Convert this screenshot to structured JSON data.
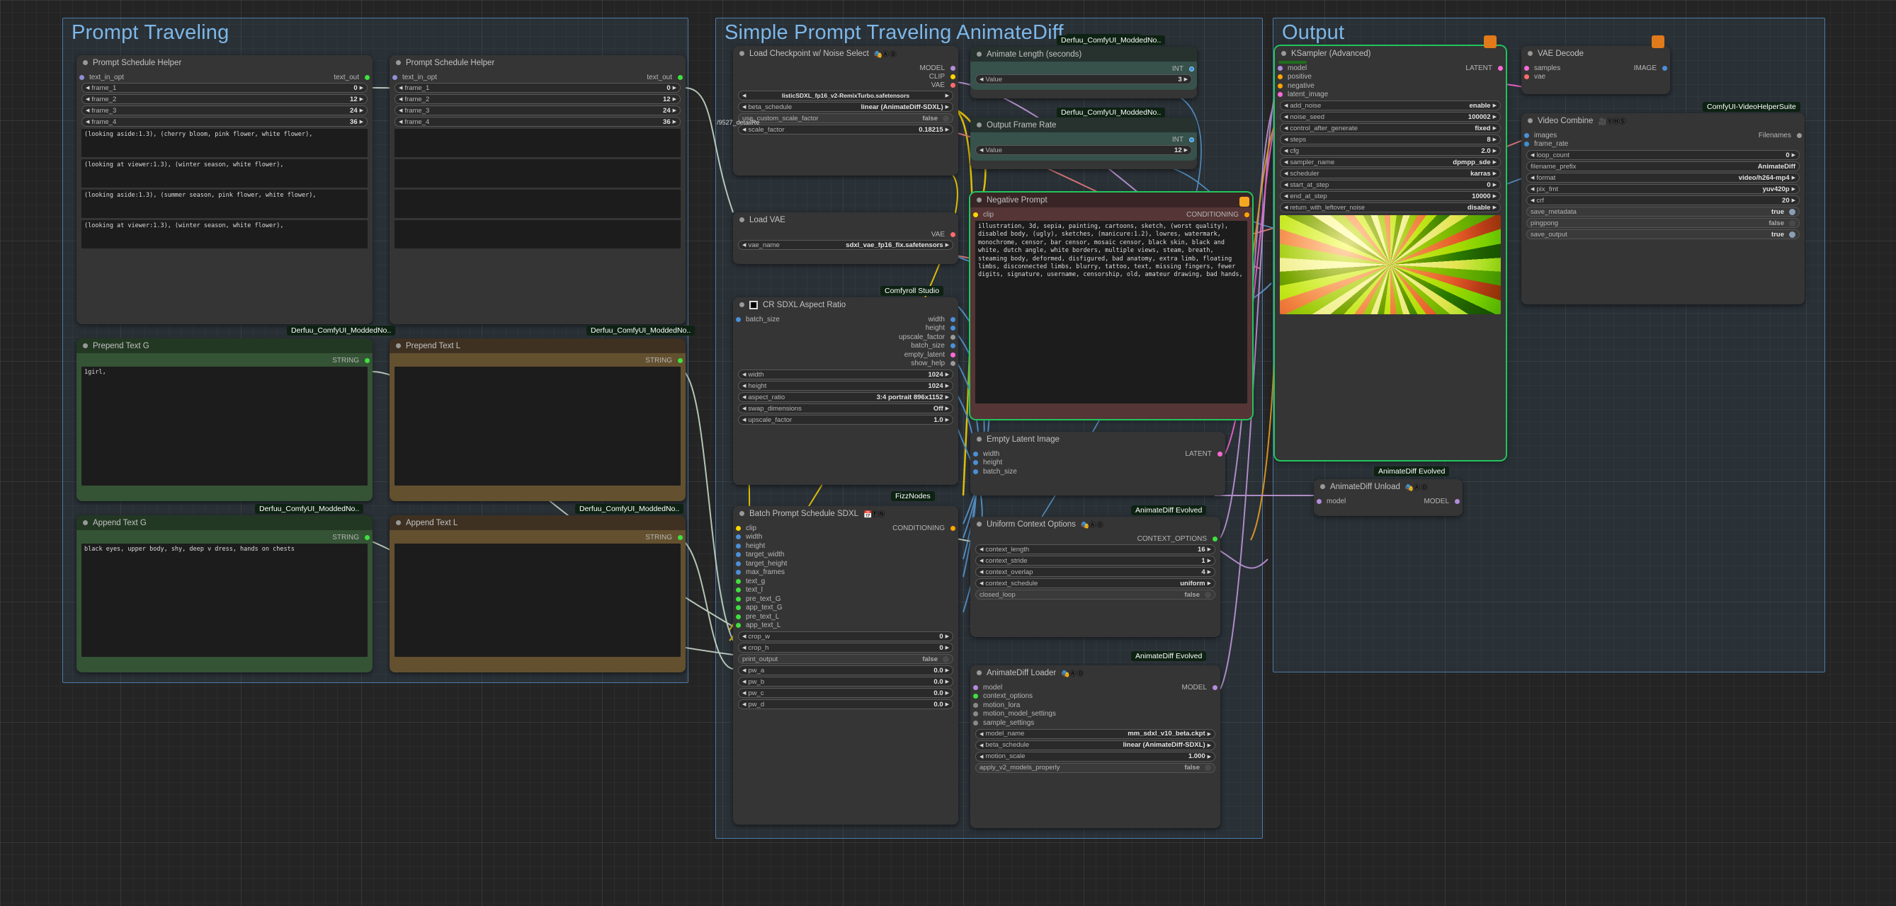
{
  "groups": [
    {
      "name": "Prompt Traveling"
    },
    {
      "name": "Simple Prompt Traveling AnimateDiff"
    },
    {
      "name": "Output"
    }
  ],
  "badges": {
    "derfuu": "Derfuu_ComfyUI_ModdedNo..",
    "animatediff": "AnimateDiff Evolved",
    "comfyroll": "Comfyroll Studio",
    "fizznodes": "FizzNodes",
    "vhs": "ComfyUI-VideoHelperSuite"
  },
  "link_labels": {
    "ckpt_link": "/9527_detailRe"
  },
  "nodes": {
    "prompt_schedule_helper_1": {
      "title": "Prompt Schedule Helper",
      "input": "text_in_opt",
      "output": "text_out",
      "widgets": [
        {
          "label": "frame_1",
          "value": "0"
        },
        {
          "label": "frame_2",
          "value": "12"
        },
        {
          "label": "frame_3",
          "value": "24"
        },
        {
          "label": "frame_4",
          "value": "36"
        }
      ],
      "texts": [
        "(looking aside:1.3), (cherry bloom, pink flower, white flower),",
        "(looking at viewer:1.3), (winter season, white flower),",
        "(looking aside:1.3), (summer season, pink flower, white flower),",
        "(looking at viewer:1.3), (winter season, white flower),"
      ]
    },
    "prompt_schedule_helper_2": {
      "title": "Prompt Schedule Helper",
      "input": "text_in_opt",
      "output": "text_out",
      "widgets": [
        {
          "label": "frame_1",
          "value": "0"
        },
        {
          "label": "frame_2",
          "value": "12"
        },
        {
          "label": "frame_3",
          "value": "24"
        },
        {
          "label": "frame_4",
          "value": "36"
        }
      ],
      "texts": [
        "",
        "",
        "",
        ""
      ]
    },
    "prepend_text_g": {
      "title": "Prepend Text G",
      "output": "STRING",
      "text": "1girl,"
    },
    "prepend_text_l": {
      "title": "Prepend Text L",
      "output": "STRING",
      "text": ""
    },
    "append_text_g": {
      "title": "Append Text G",
      "output": "STRING",
      "text": "black eyes, upper body, shy, deep v dress, hands on chests"
    },
    "append_text_l": {
      "title": "Append Text L",
      "output": "STRING",
      "text": ""
    },
    "load_checkpoint": {
      "title": "Load Checkpoint w/ Noise Select",
      "icons": "🎭Ⓐ Ⓓ",
      "outputs": [
        "MODEL",
        "CLIP",
        "VAE"
      ],
      "widgets": [
        {
          "label": "",
          "value": "listicSDXL_fp16_v2-RemixTurbo.safetensors",
          "combo": true
        },
        {
          "label": "beta_schedule",
          "value": "linear (AnimateDiff-SDXL)"
        },
        {
          "label": "use_custom_scale_factor",
          "value": "false",
          "toggle": true,
          "on": false
        },
        {
          "label": "scale_factor",
          "value": "0.18215"
        }
      ]
    },
    "load_vae": {
      "title": "Load VAE",
      "outputs": [
        "VAE"
      ],
      "widgets": [
        {
          "label": "vae_name",
          "value": "sdxl_vae_fp16_fix.safetensors"
        }
      ]
    },
    "cr_sdxl_aspect_ratio": {
      "title": "CR SDXL Aspect Ratio",
      "inputs": [
        "batch_size"
      ],
      "outputs": [
        "width",
        "height",
        "upscale_factor",
        "batch_size",
        "empty_latent",
        "show_help"
      ],
      "widgets": [
        {
          "label": "width",
          "value": "1024"
        },
        {
          "label": "height",
          "value": "1024"
        },
        {
          "label": "aspect_ratio",
          "value": "3:4 portrait 896x1152"
        },
        {
          "label": "swap_dimensions",
          "value": "Off"
        },
        {
          "label": "upscale_factor",
          "value": "1.0"
        }
      ]
    },
    "batch_prompt_schedule_sdxl": {
      "title": "Batch Prompt Schedule SDXL",
      "icons": "📅ⒻⓃ",
      "inputs": [
        "clip",
        "width",
        "height",
        "target_width",
        "target_height",
        "max_frames",
        "text_g",
        "text_l",
        "pre_text_G",
        "app_text_G",
        "pre_text_L",
        "app_text_L"
      ],
      "outputs": [
        "CONDITIONING"
      ],
      "widgets": [
        {
          "label": "crop_w",
          "value": "0"
        },
        {
          "label": "crop_h",
          "value": "0"
        },
        {
          "label": "print_output",
          "value": "false",
          "toggle": true,
          "on": false
        },
        {
          "label": "pw_a",
          "value": "0.0"
        },
        {
          "label": "pw_b",
          "value": "0.0"
        },
        {
          "label": "pw_c",
          "value": "0.0"
        },
        {
          "label": "pw_d",
          "value": "0.0"
        }
      ]
    },
    "animate_length": {
      "title": "Animate Length (seconds)",
      "outputs": [
        "INT"
      ],
      "widgets": [
        {
          "label": "Value",
          "value": "3"
        }
      ]
    },
    "output_frame_rate": {
      "title": "Output Frame Rate",
      "outputs": [
        "INT"
      ],
      "widgets": [
        {
          "label": "Value",
          "value": "12"
        }
      ]
    },
    "negative_prompt": {
      "title": "Negative Prompt",
      "inputs": [
        "clip"
      ],
      "outputs": [
        "CONDITIONING"
      ],
      "text": "illustration, 3d, sepia, painting, cartoons, sketch, (worst quality), disabled body, (ugly), sketches, (manicure:1.2), lowres, watermark, monochrome, censor, bar censor, mosaic censor, black skin, black and white, dutch angle, white borders, multiple views, steam, breath, steaming body, deformed, disfigured, bad anatomy, extra limb, floating limbs, disconnected limbs, blurry, tattoo, text, missing fingers, fewer digits, signature, username, censorship, old, amateur drawing, bad hands,"
    },
    "empty_latent_image": {
      "title": "Empty Latent Image",
      "inputs": [
        "width",
        "height",
        "batch_size"
      ],
      "outputs": [
        "LATENT"
      ]
    },
    "uniform_context_options": {
      "title": "Uniform Context Options",
      "icons": "🎭Ⓐ Ⓓ",
      "outputs": [
        "CONTEXT_OPTIONS"
      ],
      "widgets": [
        {
          "label": "context_length",
          "value": "16"
        },
        {
          "label": "context_stride",
          "value": "1"
        },
        {
          "label": "context_overlap",
          "value": "4"
        },
        {
          "label": "context_schedule",
          "value": "uniform"
        },
        {
          "label": "closed_loop",
          "value": "false",
          "toggle": true,
          "on": false
        }
      ]
    },
    "animatediff_loader": {
      "title": "AnimateDiff Loader",
      "icons": "🎭Ⓐ Ⓓ",
      "inputs": [
        "model",
        "context_options",
        "motion_lora",
        "motion_model_settings",
        "sample_settings"
      ],
      "outputs": [
        "MODEL"
      ],
      "widgets": [
        {
          "label": "model_name",
          "value": "mm_sdxl_v10_beta.ckpt"
        },
        {
          "label": "beta_schedule",
          "value": "linear (AnimateDiff-SDXL)"
        },
        {
          "label": "motion_scale",
          "value": "1.000"
        },
        {
          "label": "apply_v2_models_properly",
          "value": "false",
          "toggle": true,
          "on": false
        }
      ]
    },
    "ksampler_advanced": {
      "title": "KSampler (Advanced)",
      "inputs": [
        "model",
        "positive",
        "negative",
        "latent_image"
      ],
      "outputs": [
        "LATENT"
      ],
      "widgets": [
        {
          "label": "add_noise",
          "value": "enable"
        },
        {
          "label": "noise_seed",
          "value": "100002"
        },
        {
          "label": "control_after_generate",
          "value": "fixed"
        },
        {
          "label": "steps",
          "value": "8"
        },
        {
          "label": "cfg",
          "value": "2.0"
        },
        {
          "label": "sampler_name",
          "value": "dpmpp_sde"
        },
        {
          "label": "scheduler",
          "value": "karras"
        },
        {
          "label": "start_at_step",
          "value": "0"
        },
        {
          "label": "end_at_step",
          "value": "10000"
        },
        {
          "label": "return_with_leftover_noise",
          "value": "disable"
        }
      ]
    },
    "animatediff_unload": {
      "title": "AnimateDiff Unload",
      "icons": "🎭Ⓐ Ⓓ",
      "inputs": [
        "model"
      ],
      "outputs": [
        "MODEL"
      ]
    },
    "vae_decode": {
      "title": "VAE Decode",
      "inputs": [
        "samples",
        "vae"
      ],
      "outputs": [
        "IMAGE"
      ]
    },
    "video_combine": {
      "title": "Video Combine",
      "icons": "🎥ⓋⒽⓈ",
      "inputs": [
        "images",
        "frame_rate"
      ],
      "outputs": [
        "Filenames"
      ],
      "widgets": [
        {
          "label": "loop_count",
          "value": "0"
        },
        {
          "label": "filename_prefix",
          "value": "AnimateDiff",
          "combo": true
        },
        {
          "label": "format",
          "value": "video/h264-mp4"
        },
        {
          "label": "pix_fmt",
          "value": "yuv420p"
        },
        {
          "label": "crf",
          "value": "20"
        },
        {
          "label": "save_metadata",
          "value": "true",
          "toggle": true,
          "on": true
        },
        {
          "label": "pingpong",
          "value": "false",
          "toggle": true,
          "on": false
        },
        {
          "label": "save_output",
          "value": "true",
          "toggle": true,
          "on": true
        }
      ]
    }
  }
}
